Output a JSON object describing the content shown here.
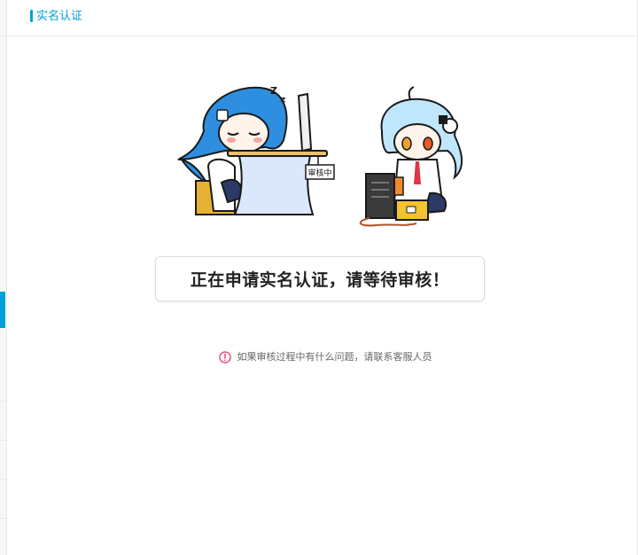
{
  "header": {
    "title": "实名认证"
  },
  "illustration": {
    "sign_text": "审核中"
  },
  "status": {
    "message": "正在申请实名认证，请等待审核！"
  },
  "hint": {
    "icon": "exclamation-circle-icon",
    "text": "如果审核过程中有什么问题，请联系客服人员"
  },
  "colors": {
    "accent": "#00a1d6",
    "hint_icon": "#e5547a",
    "text_dark": "#222222",
    "text_muted": "#666666"
  }
}
